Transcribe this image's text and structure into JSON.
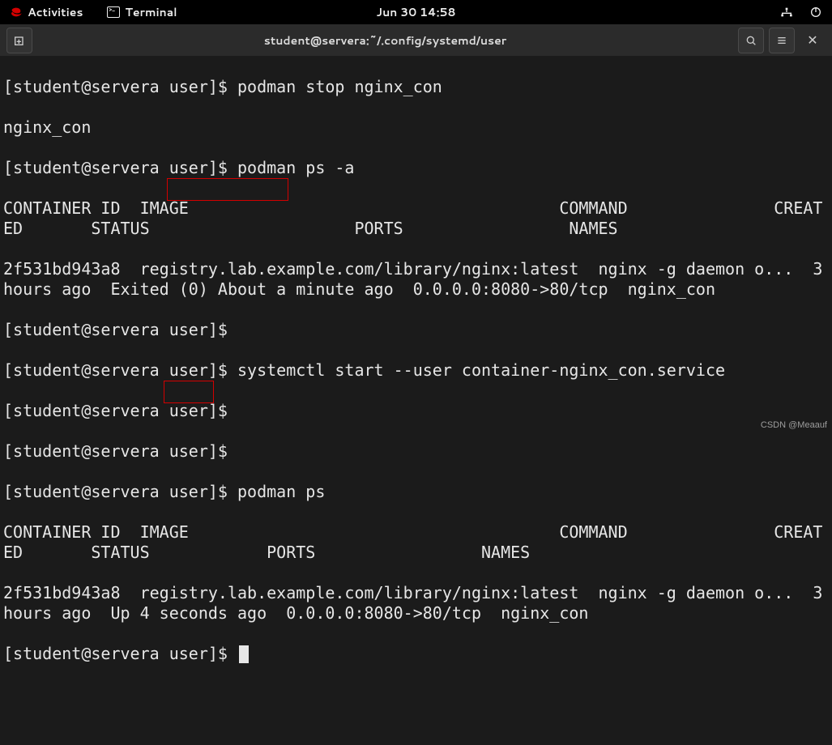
{
  "topbar": {
    "activities": "Activities",
    "terminal": "Terminal",
    "datetime": "Jun 30  14:58"
  },
  "titlebar": {
    "title": "student@servera:~/.config/systemd/user"
  },
  "prompt": "[student@servera user]$ ",
  "cmds": {
    "stop": "podman stop nginx_con",
    "psa": "podman ps -a",
    "start": "systemctl start --user container-nginx_con.service",
    "ps": "podman ps"
  },
  "out": {
    "stop_echo": "nginx_con",
    "header_long": "CONTAINER ID  IMAGE                                      COMMAND               CREATED       STATUS                     PORTS                 NAMES",
    "row_exited": "2f531bd943a8  registry.lab.example.com/library/nginx:latest  nginx -g daemon o...  3 hours ago  Exited (0) About a minute ago  0.0.0.0:8080->80/tcp  nginx_con",
    "header_short": "CONTAINER ID  IMAGE                                      COMMAND               CREATED       STATUS            PORTS                 NAMES",
    "row_up": "2f531bd943a8  registry.lab.example.com/library/nginx:latest  nginx -g daemon o...  3 hours ago  Up 4 seconds ago  0.0.0.0:8080->80/tcp  nginx_con"
  },
  "highlight_labels": {
    "exited": "Exited (0)",
    "up": "Up 4"
  },
  "watermark": "CSDN @Meaauf"
}
